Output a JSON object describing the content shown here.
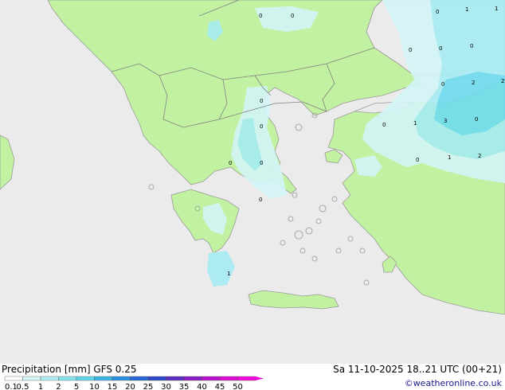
{
  "title": "Precipitation [mm]  GFS 0.25",
  "datetime": "Sa 11-10-2025 18..21 UTC (00+21)",
  "credit": "©weatheronline.co.uk",
  "colors": {
    "sea": "#ebebeb",
    "land": "#c2f2a1",
    "coast": "#9a9a9a",
    "border": "#808080",
    "precip_light": "#d4f5f8",
    "precip_mid": "#a6ecf3",
    "precip_heavy": "#6fdbee"
  },
  "scale": {
    "labels": [
      "0.1",
      "0.5",
      "1",
      "2",
      "5",
      "10",
      "15",
      "20",
      "25",
      "30",
      "35",
      "40",
      "45",
      "50"
    ],
    "colors": [
      "#fefefe",
      "#d8f5f7",
      "#b0ecf1",
      "#86e3ec",
      "#5ed5e8",
      "#3db4e6",
      "#2a8ee0",
      "#2668d6",
      "#2e46c8",
      "#5c2ec0",
      "#8a1cc4",
      "#b810cc",
      "#dd0ad2",
      "#f20ade"
    ]
  },
  "map_labels": [
    {
      "text": "0"
    },
    {
      "text": "0"
    },
    {
      "text": "0"
    },
    {
      "text": "1"
    },
    {
      "text": "1"
    },
    {
      "text": "0"
    },
    {
      "text": "0"
    },
    {
      "text": "0"
    },
    {
      "text": "0"
    },
    {
      "text": "2"
    },
    {
      "text": "2"
    },
    {
      "text": "0"
    },
    {
      "text": "1"
    },
    {
      "text": "3"
    },
    {
      "text": "0"
    },
    {
      "text": "0"
    },
    {
      "text": "1"
    },
    {
      "text": "2"
    },
    {
      "text": "0"
    },
    {
      "text": "0"
    },
    {
      "text": "0"
    },
    {
      "text": "0"
    },
    {
      "text": "1"
    }
  ]
}
